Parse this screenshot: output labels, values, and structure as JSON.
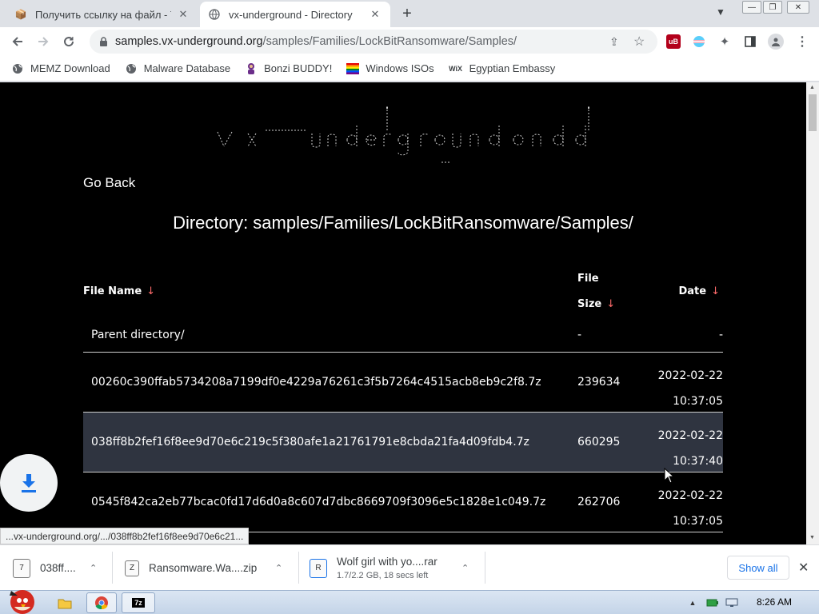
{
  "tabs": [
    {
      "title": "Получить ссылку на файл - Te",
      "active": false
    },
    {
      "title": "vx-underground - Directory",
      "active": true
    }
  ],
  "toolbar": {
    "url_host": "samples.vx-underground.org",
    "url_path": "/samples/Families/LockBitRansomware/Samples/"
  },
  "bookmarks": [
    {
      "label": "MEMZ Download",
      "icon": "globe-icon"
    },
    {
      "label": "Malware Database",
      "icon": "globe-icon"
    },
    {
      "label": "Bonzi BUDDY!",
      "icon": "bonzi-icon"
    },
    {
      "label": "Windows ISOs",
      "icon": "windows-flag-icon"
    },
    {
      "label": "Egyptian Embassy",
      "icon": "wix-icon"
    }
  ],
  "page": {
    "go_back": "Go Back",
    "directory_title": "Directory: samples/Families/LockBitRansomware/Samples/",
    "headers": {
      "name": "File Name",
      "size_line1": "File",
      "size_line2": "Size",
      "date": "Date",
      "sort_arrow": "↓"
    },
    "parent": {
      "name": "Parent directory/",
      "size": "-",
      "date": "-"
    },
    "rows": [
      {
        "name": "00260c390ffab5734208a7199df0e4229a76261c3f5b7264c4515acb8eb9c2f8.7z",
        "size": "239634",
        "date": "2022-02-22",
        "time": "10:37:05"
      },
      {
        "name": "038ff8b2fef16f8ee9d70e6c219c5f380afe1a21761791e8cbda21fa4d09fdb4.7z",
        "size": "660295",
        "date": "2022-02-22",
        "time": "10:37:40"
      },
      {
        "name": "0545f842ca2eb77bcac0fd17d6d0a8c607d7dbc8669709f3096e5c1828e1c049.7z",
        "size": "262706",
        "date": "2022-02-22",
        "time": "10:37:05"
      }
    ],
    "status_url": "...vx-underground.org/.../038ff8b2fef16f8ee9d70e6c21..."
  },
  "downloads": [
    {
      "name": "038ff....",
      "detail": ""
    },
    {
      "name": "Ransomware.Wa....zip",
      "detail": ""
    },
    {
      "name": "Wolf girl with yo....rar",
      "detail": "1.7/2.2 GB, 18 secs left"
    }
  ],
  "shelf": {
    "show_all": "Show all"
  },
  "taskbar": {
    "clock": "8:26 AM"
  },
  "colors": {
    "page_bg": "#000000",
    "highlight_row": "#2f3440",
    "sort_arrow": "#ff6b6b",
    "link_blue": "#1a73e8"
  }
}
